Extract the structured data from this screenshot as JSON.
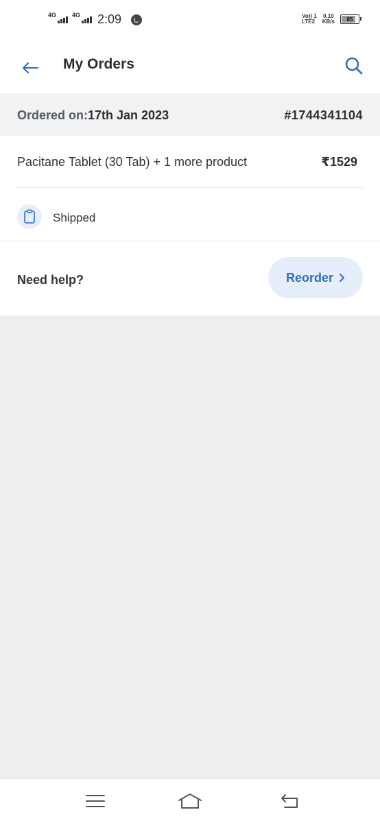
{
  "status_bar": {
    "network1": "4G",
    "network2": "4G",
    "time": "2:09",
    "volte_line1": "Vo)) 1",
    "volte_line2": "LTE2",
    "speed_value": "0.10",
    "speed_unit": "KB/s",
    "battery_level": "85",
    "icons": [
      "signal-icon",
      "signal-icon",
      "whatsapp-icon",
      "battery-icon"
    ]
  },
  "header": {
    "title": "My Orders",
    "back_icon": "arrow-left-icon",
    "search_icon": "search-icon",
    "accent_color": "#2f6fc1"
  },
  "order": {
    "ordered_on_label": "Ordered on:",
    "ordered_on_date": "17th Jan 2023",
    "order_id": "#1744341104",
    "product_summary": "Pacitane Tablet (30 Tab) + 1 more product",
    "price": "₹1529",
    "status": "Shipped",
    "status_icon": "clipboard-icon",
    "help_label": "Need help?",
    "reorder_label": "Reorder",
    "reorder_icon": "chevron-right-icon"
  },
  "nav_bar": {
    "icons": [
      "menu-icon",
      "home-icon",
      "back-icon"
    ]
  }
}
